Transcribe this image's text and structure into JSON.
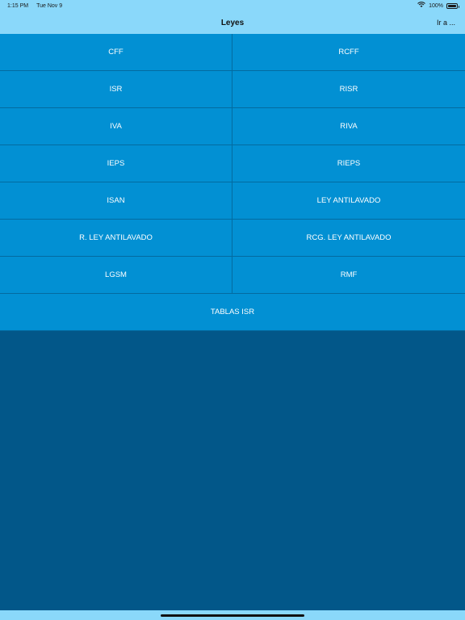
{
  "status_bar": {
    "time": "1:15 PM",
    "date": "Tue Nov 9",
    "battery_text": "100%",
    "wifi_icon": "wifi-icon",
    "battery_icon": "battery-icon"
  },
  "nav": {
    "title": "Leyes",
    "action_label": "Ir a ..."
  },
  "laws": [
    {
      "label": "CFF"
    },
    {
      "label": "RCFF"
    },
    {
      "label": "ISR"
    },
    {
      "label": "RISR"
    },
    {
      "label": "IVA"
    },
    {
      "label": "RIVA"
    },
    {
      "label": "IEPS"
    },
    {
      "label": "RIEPS"
    },
    {
      "label": "ISAN"
    },
    {
      "label": "LEY ANTILAVADO"
    },
    {
      "label": "R. LEY ANTILAVADO"
    },
    {
      "label": "RCG. LEY ANTILAVADO"
    },
    {
      "label": "LGSM"
    },
    {
      "label": "RMF"
    },
    {
      "label": "TABLAS ISR"
    }
  ],
  "colors": {
    "bars": "#8ad8fa",
    "cell": "#0290d3",
    "cell_border": "#036ba0",
    "background": "#025789"
  }
}
